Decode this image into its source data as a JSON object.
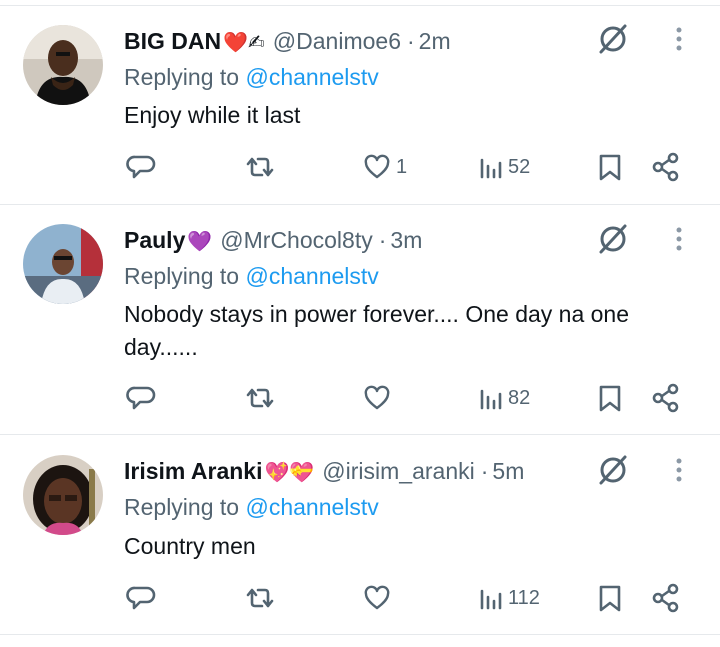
{
  "tweets": [
    {
      "name": "BIG DAN",
      "name_emoji": "❤️✍",
      "handle": "@Danimoe6",
      "separator": "·",
      "time": "2m",
      "replying_prefix": "Replying to ",
      "replying_to": "@channelstv",
      "text": "Enjoy while it last",
      "likes": "1",
      "views": "52"
    },
    {
      "name": "Pauly",
      "name_emoji": "💜",
      "handle": "@MrChocol8ty",
      "separator": "·",
      "time": "3m",
      "replying_prefix": "Replying to ",
      "replying_to": "@channelstv",
      "text": "Nobody stays in power forever.... One day na one day......",
      "likes": "",
      "views": "82"
    },
    {
      "name": "Irisim Aranki",
      "name_emoji": "💖💝",
      "handle": "@irisim_aranki",
      "separator": "·",
      "time": "5m",
      "replying_prefix": "Replying to ",
      "replying_to": "@channelstv",
      "text": "Country men",
      "likes": "",
      "views": "112"
    }
  ],
  "icons": {
    "reply": "reply-icon",
    "retweet": "retweet-icon",
    "like": "heart-icon",
    "views": "views-icon",
    "bookmark": "bookmark-icon",
    "share": "share-icon",
    "grok": "grok-icon",
    "more": "more-icon"
  },
  "colors": {
    "text": "#0f1419",
    "secondary": "#536471",
    "link": "#1d9bf0",
    "divider": "#e6e9ec",
    "heart_emoji": "#e0245e",
    "purple_heart": "#8e44ad"
  }
}
